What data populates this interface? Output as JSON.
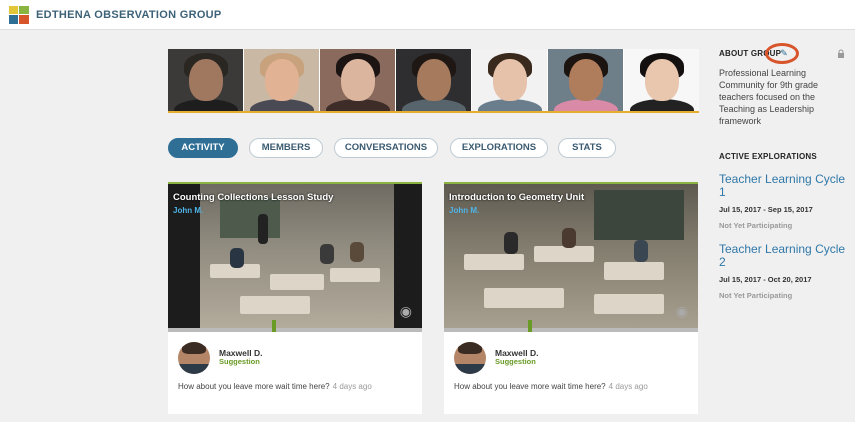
{
  "header": {
    "brand": "EDTHENA OBSERVATION GROUP",
    "logo_colors": [
      "#e3c53a",
      "#8ab340",
      "#2f6f95",
      "#d8542b"
    ]
  },
  "members_strip": {
    "photos": [
      {
        "skin": "#a07860",
        "hair": "#2a2622",
        "bg": "#3b3a38",
        "shirt": "#1e1e1e"
      },
      {
        "skin": "#e2b295",
        "hair": "#c8a27c",
        "bg": "#c9b8a4",
        "shirt": "#4a4a55"
      },
      {
        "skin": "#dcb59e",
        "hair": "#1b1412",
        "bg": "#8a6a5c",
        "shirt": "#3d2c28"
      },
      {
        "skin": "#a57a5d",
        "hair": "#1e1714",
        "bg": "#2e2e30",
        "shirt": "#58646c"
      },
      {
        "skin": "#e7c2ab",
        "hair": "#3a2a1e",
        "bg": "#f2f2f2",
        "shirt": "#6a7d8c"
      },
      {
        "skin": "#b07d5c",
        "hair": "#1c1410",
        "bg": "#6f7f8a",
        "shirt": "#d98aa6"
      },
      {
        "skin": "#e9c7ae",
        "hair": "#151010",
        "bg": "#f7f7f7",
        "shirt": "#222222"
      }
    ]
  },
  "tabs": [
    {
      "label": "ACTIVITY",
      "active": true
    },
    {
      "label": "MEMBERS",
      "active": false
    },
    {
      "label": "CONVERSATIONS",
      "active": false
    },
    {
      "label": "EXPLORATIONS",
      "active": false
    },
    {
      "label": "STATS",
      "active": false
    }
  ],
  "cards": [
    {
      "title": "Counting Collections Lesson Study",
      "author": "John M.",
      "marker_position": 0.41,
      "commenter": "Maxwell D.",
      "comment_type": "Suggestion",
      "comment": "How about you leave more wait time here?",
      "time": "4 days ago"
    },
    {
      "title": "Introduction to Geometry Unit",
      "author": "John M.",
      "marker_position": 0.33,
      "commenter": "Maxwell D.",
      "comment_type": "Suggestion",
      "comment": "How about you leave more wait time here?",
      "time": "4 days ago"
    }
  ],
  "sidebar": {
    "about_heading": "ABOUT GROUP",
    "about_text": "Professional Learning Community for 9th grade teachers focused on the Teaching as Leadership framework",
    "explorations_heading": "ACTIVE EXPLORATIONS",
    "explorations": [
      {
        "title": "Teacher Learning Cycle 1",
        "dates": "Jul 15, 2017 - Sep 15, 2017",
        "status": "Not Yet Participating"
      },
      {
        "title": "Teacher Learning Cycle 2",
        "dates": "Jul 15, 2017 - Oct 20, 2017",
        "status": "Not Yet Participating"
      }
    ]
  },
  "icons": {
    "edit": "pencil-icon",
    "lock": "lock-icon",
    "insight": "lightbulb-icon"
  },
  "accent_colors": {
    "primary": "#2f6f95",
    "link": "#2f78a8",
    "green": "#6a9b27",
    "annotation": "#d8542b"
  }
}
